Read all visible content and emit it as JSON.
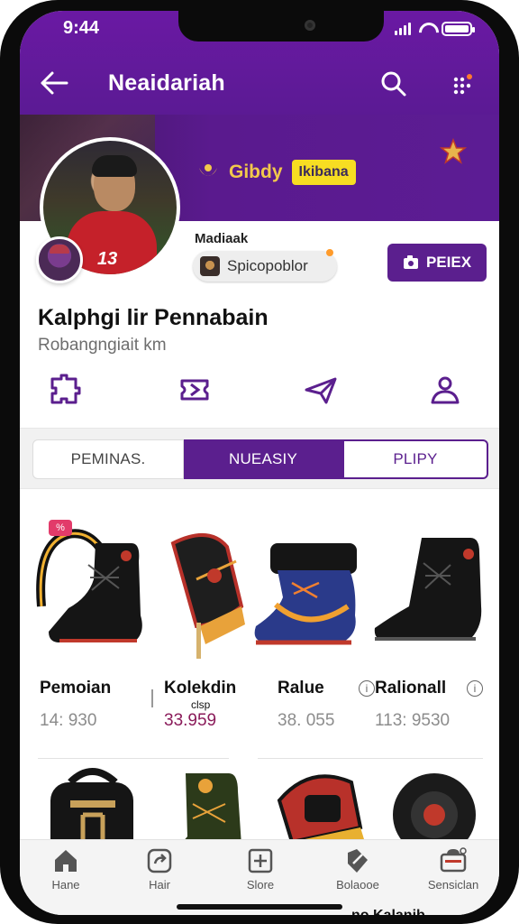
{
  "status": {
    "time": "9:44"
  },
  "header": {
    "title": "Neaidariah"
  },
  "profile": {
    "brand_name": "Gibdy",
    "brand_badge": "Ikibana",
    "small_label": "Madiaak",
    "chip_label": "Spicopoblor",
    "action_button": "PEIEX",
    "name": "Kalphgi lir Pennabain",
    "subtitle": "Robangngiait km",
    "player_number": "13"
  },
  "tabs": [
    {
      "label": "PEMINAS."
    },
    {
      "label": "NUEASIY"
    },
    {
      "label": "PLIPY"
    }
  ],
  "products": [
    {
      "title": "Pemoian",
      "price": "14: 930",
      "tag": "%"
    },
    {
      "title": "Kolekdin",
      "subtitle": "clsp",
      "price": "33.959"
    },
    {
      "title": "Ralue",
      "price": "38. 055"
    },
    {
      "title": "Ralionall",
      "price": "113: 9530"
    }
  ],
  "info_icon_label": "i",
  "bottom_nav": [
    {
      "label": "Hane",
      "icon": "home-icon"
    },
    {
      "label": "Hair",
      "icon": "share-icon"
    },
    {
      "label": "Slore",
      "icon": "plus-box-icon"
    },
    {
      "label": "Bolaooe",
      "icon": "tag-icon"
    },
    {
      "label": "Sensiclan",
      "icon": "profile-card-icon"
    }
  ],
  "peek": {
    "right_text": "no Kalanib"
  },
  "colors": {
    "primary_purple": "#5b1f8e",
    "header_purple": "#6a19a3",
    "badge_yellow": "#f7dd22",
    "accent_price": "#8a1b5a"
  }
}
